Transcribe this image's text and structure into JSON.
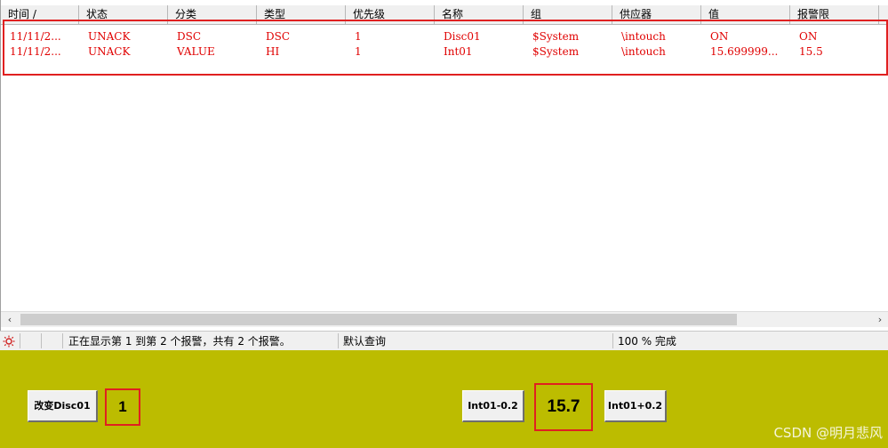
{
  "columns": [
    "时间 /",
    "状态",
    "分类",
    "类型",
    "优先级",
    "名称",
    "组",
    "供应器",
    "值",
    "报警限"
  ],
  "rows": [
    [
      "11/11/2...",
      "UNACK",
      "DSC",
      "DSC",
      "1",
      "Disc01",
      "$System",
      "\\intouch",
      "ON",
      "ON"
    ],
    [
      "11/11/2...",
      "UNACK",
      "VALUE",
      "HI",
      "1",
      "Int01",
      "$System",
      "\\intouch",
      "15.699999...",
      "15.5"
    ]
  ],
  "row_color": "#e00000",
  "scrollbar": {
    "left_arrow": "‹",
    "right_arrow": "›"
  },
  "statusbar": {
    "icon": "alarm-sun-icon",
    "message": "正在显示第 1 到第 2 个报警，共有 2 个报警。",
    "query": "默认查询",
    "progress": "100 % 完成"
  },
  "panel": {
    "background": "#bcbc00",
    "disc_button": "改变Disc01",
    "disc_value": "1",
    "int_minus_button": "Int01-0.2",
    "int_value": "15.7",
    "int_plus_button": "Int01+0.2"
  },
  "highlight_color": "#e02020",
  "watermark": "CSDN @明月悲风"
}
